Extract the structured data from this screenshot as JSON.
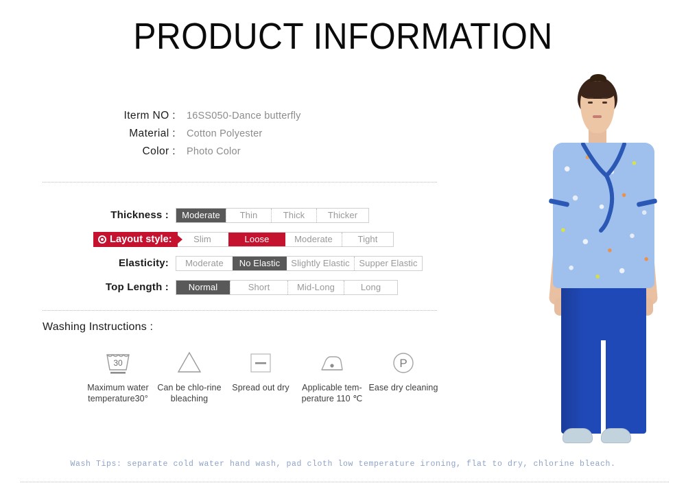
{
  "title": "PRODUCT INFORMATION",
  "info": {
    "rows": [
      {
        "label": "Iterm NO :",
        "value": "16SS050-Dance butterfly"
      },
      {
        "label": "Material  :",
        "value": "Cotton Polyester"
      },
      {
        "label": "Color :",
        "value": "Photo Color"
      }
    ]
  },
  "specs": {
    "rows": [
      {
        "label": "Thickness :",
        "highlight": false,
        "options": [
          {
            "text": "Moderate",
            "state": "selected-gray",
            "width": 72
          },
          {
            "text": "Thin",
            "state": "normal",
            "width": 66
          },
          {
            "text": "Thick",
            "state": "normal",
            "width": 66
          },
          {
            "text": "Thicker",
            "state": "normal",
            "width": 76
          }
        ]
      },
      {
        "label": "Layout style:",
        "highlight": true,
        "options": [
          {
            "text": "Slim",
            "state": "normal",
            "width": 76
          },
          {
            "text": "Loose",
            "state": "selected-red",
            "width": 83
          },
          {
            "text": "Moderate",
            "state": "normal",
            "width": 82
          },
          {
            "text": "Tight",
            "state": "normal",
            "width": 75
          }
        ]
      },
      {
        "label": "Elasticity:",
        "highlight": false,
        "options": [
          {
            "text": "Moderate",
            "state": "normal",
            "width": 82
          },
          {
            "text": "No Elastic",
            "state": "selected-gray",
            "width": 79
          },
          {
            "text": "Slightly Elastic",
            "state": "normal",
            "width": 98
          },
          {
            "text": "Supper  Elastic",
            "state": "normal",
            "width": 99
          }
        ]
      },
      {
        "label": "Top Length :",
        "highlight": false,
        "options": [
          {
            "text": "Normal",
            "state": "selected-gray",
            "width": 78
          },
          {
            "text": "Short",
            "state": "normal",
            "width": 84
          },
          {
            "text": "Mid-Long",
            "state": "normal",
            "width": 82
          },
          {
            "text": "Long",
            "state": "normal",
            "width": 78
          }
        ]
      }
    ]
  },
  "washing": {
    "title": "Washing Instructions :",
    "items": [
      {
        "icon": "wash-tub-30-icon",
        "caption": "Maximum water temperature30°",
        "value": "30"
      },
      {
        "icon": "bleach-triangle-icon",
        "caption": "Can be chlo-rine bleaching"
      },
      {
        "icon": "flat-dry-square-icon",
        "caption": "Spread out dry"
      },
      {
        "icon": "iron-one-dot-icon",
        "caption": "Applicable tem-perature 110 ℃"
      },
      {
        "icon": "dry-clean-p-icon",
        "caption": "Ease dry cleaning"
      }
    ]
  },
  "wash_tips": "Wash Tips: separate cold water hand wash, pad cloth low temperature ironing, flat to dry, chlorine bleach.",
  "colors": {
    "accent_red": "#c4122f",
    "selected_gray": "#595959",
    "tips_blue": "#8fa3c6",
    "garment_top": "#9fc0ec",
    "garment_trim": "#2b57b5",
    "pants_blue": "#2049b8"
  },
  "model": {
    "alt": "female-model-wearing-blue-floral-scrub-top-and-royal-blue-scrub-pants"
  }
}
